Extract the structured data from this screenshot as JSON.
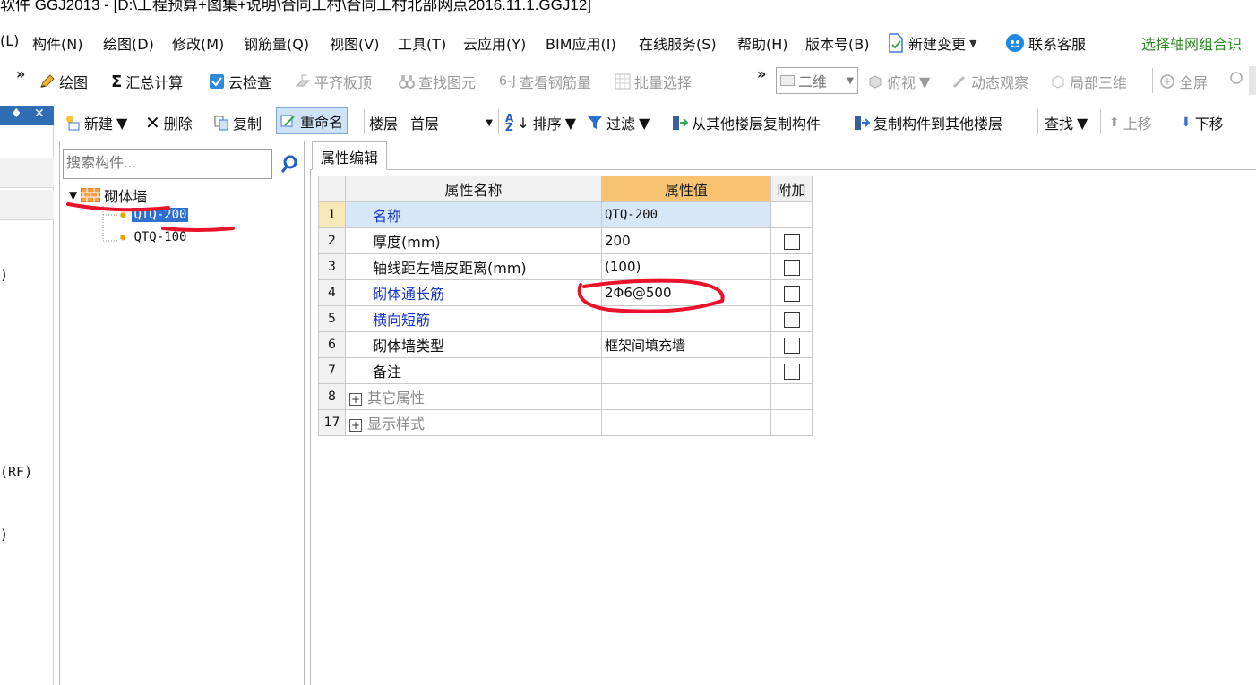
{
  "title": "软件 GGJ2013 - [D:\\工程预算+图集+说明\\合同工村\\合同工村北部网点2016.11.1.GGJ12]",
  "menu": {
    "items": [
      "(L)",
      "构件(N)",
      "绘图(D)",
      "修改(M)",
      "钢筋量(Q)",
      "视图(V)",
      "工具(T)",
      "云应用(Y)",
      "BIM应用(I)",
      "在线服务(S)",
      "帮助(H)",
      "版本号(B)"
    ],
    "new_change": "新建变更",
    "contact": "联系客服",
    "axis_group": "选择轴网组合识"
  },
  "toolbar1": {
    "draw": "绘图",
    "sum": "汇总计算",
    "cloud_check": "云检查",
    "flush_slab": "平齐板顶",
    "find_element": "查找图元",
    "view_rebar": "查看钢筋量",
    "batch_select": "批量选择",
    "view_mode": "二维",
    "top_view": "俯视",
    "dynamic_view": "动态观察",
    "partial_3d": "局部三维",
    "fullscreen": "全屏"
  },
  "toolbar2": {
    "new": "新建",
    "delete": "删除",
    "copy": "复制",
    "rename": "重命名",
    "floor_label": "楼层",
    "floor_value": "首层",
    "sort": "排序",
    "filter": "过滤",
    "copy_from_floor": "从其他楼层复制构件",
    "copy_to_floor": "复制构件到其他楼层",
    "find": "查找",
    "move_up": "上移",
    "move_down": "下移"
  },
  "left_strip": {
    "texts": [
      ")",
      "(RF)",
      ")"
    ]
  },
  "tree": {
    "search_placeholder": "搜索构件...",
    "root": "砌体墙",
    "children": [
      "QTQ-200",
      "QTQ-100"
    ]
  },
  "tab": {
    "label": "属性编辑"
  },
  "props": {
    "headers": {
      "num": "",
      "name": "属性名称",
      "value": "属性值",
      "add": "附加"
    },
    "rows": [
      {
        "num": "1",
        "name": "名称",
        "value": "QTQ-200",
        "check": false
      },
      {
        "num": "2",
        "name": "厚度(mm)",
        "value": "200",
        "check": true
      },
      {
        "num": "3",
        "name": "轴线距左墙皮距离(mm)",
        "value": "(100)",
        "check": true
      },
      {
        "num": "4",
        "name": "砌体通长筋",
        "value": "2Φ6@500",
        "check": true
      },
      {
        "num": "5",
        "name": "横向短筋",
        "value": "",
        "check": true
      },
      {
        "num": "6",
        "name": "砌体墙类型",
        "value": "框架间填充墙",
        "check": true
      },
      {
        "num": "7",
        "name": "备注",
        "value": "",
        "check": true
      },
      {
        "num": "8",
        "name": "其它属性",
        "value": "",
        "check": false
      },
      {
        "num": "17",
        "name": "显示样式",
        "value": "",
        "check": false
      }
    ]
  },
  "colors": {
    "accent_blue": "#2f6fcf",
    "value_header": "#f7c371",
    "link_blue": "#1736c9",
    "annotation_red": "#e8132a"
  }
}
